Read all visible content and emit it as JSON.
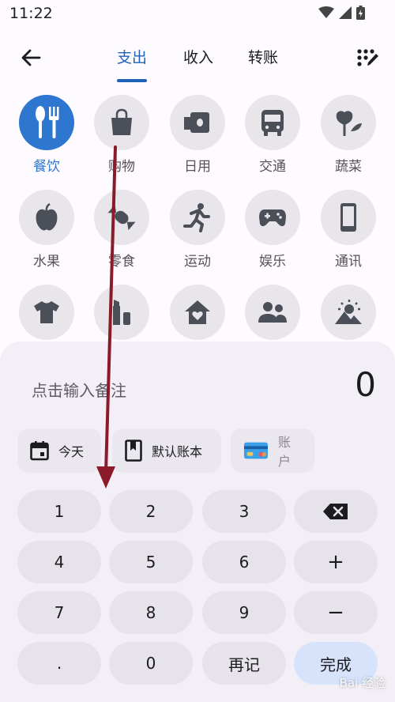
{
  "status_bar": {
    "time": "11:22"
  },
  "header": {
    "tabs": [
      {
        "label": "支出",
        "active": true
      },
      {
        "label": "收入",
        "active": false
      },
      {
        "label": "转账",
        "active": false
      }
    ]
  },
  "categories": [
    {
      "label": "餐饮",
      "icon": "utensils-icon",
      "selected": true
    },
    {
      "label": "购物",
      "icon": "shopping-bag-icon"
    },
    {
      "label": "日用",
      "icon": "tissue-roll-icon"
    },
    {
      "label": "交通",
      "icon": "bus-icon"
    },
    {
      "label": "蔬菜",
      "icon": "vegetable-icon"
    },
    {
      "label": "水果",
      "icon": "apple-icon"
    },
    {
      "label": "零食",
      "icon": "candy-icon"
    },
    {
      "label": "运动",
      "icon": "running-icon"
    },
    {
      "label": "娱乐",
      "icon": "gamepad-icon"
    },
    {
      "label": "通讯",
      "icon": "phone-icon"
    },
    {
      "icon": "tshirt-icon"
    },
    {
      "icon": "cosmetics-icon"
    },
    {
      "icon": "home-heart-icon"
    },
    {
      "icon": "people-icon"
    },
    {
      "icon": "landscape-icon"
    }
  ],
  "entry": {
    "note_placeholder": "点击输入备注",
    "amount": "0",
    "date_label": "今天",
    "book_label": "默认账本",
    "account_label": "账户"
  },
  "keypad": {
    "k1": "1",
    "k2": "2",
    "k3": "3",
    "k4": "4",
    "k5": "5",
    "k6": "6",
    "k7": "7",
    "k8": "8",
    "k9": "9",
    "dot": ".",
    "k0": "0",
    "plus": "+",
    "minus": "−",
    "again": "再记",
    "done": "完成"
  },
  "watermark": "Bai 经验"
}
